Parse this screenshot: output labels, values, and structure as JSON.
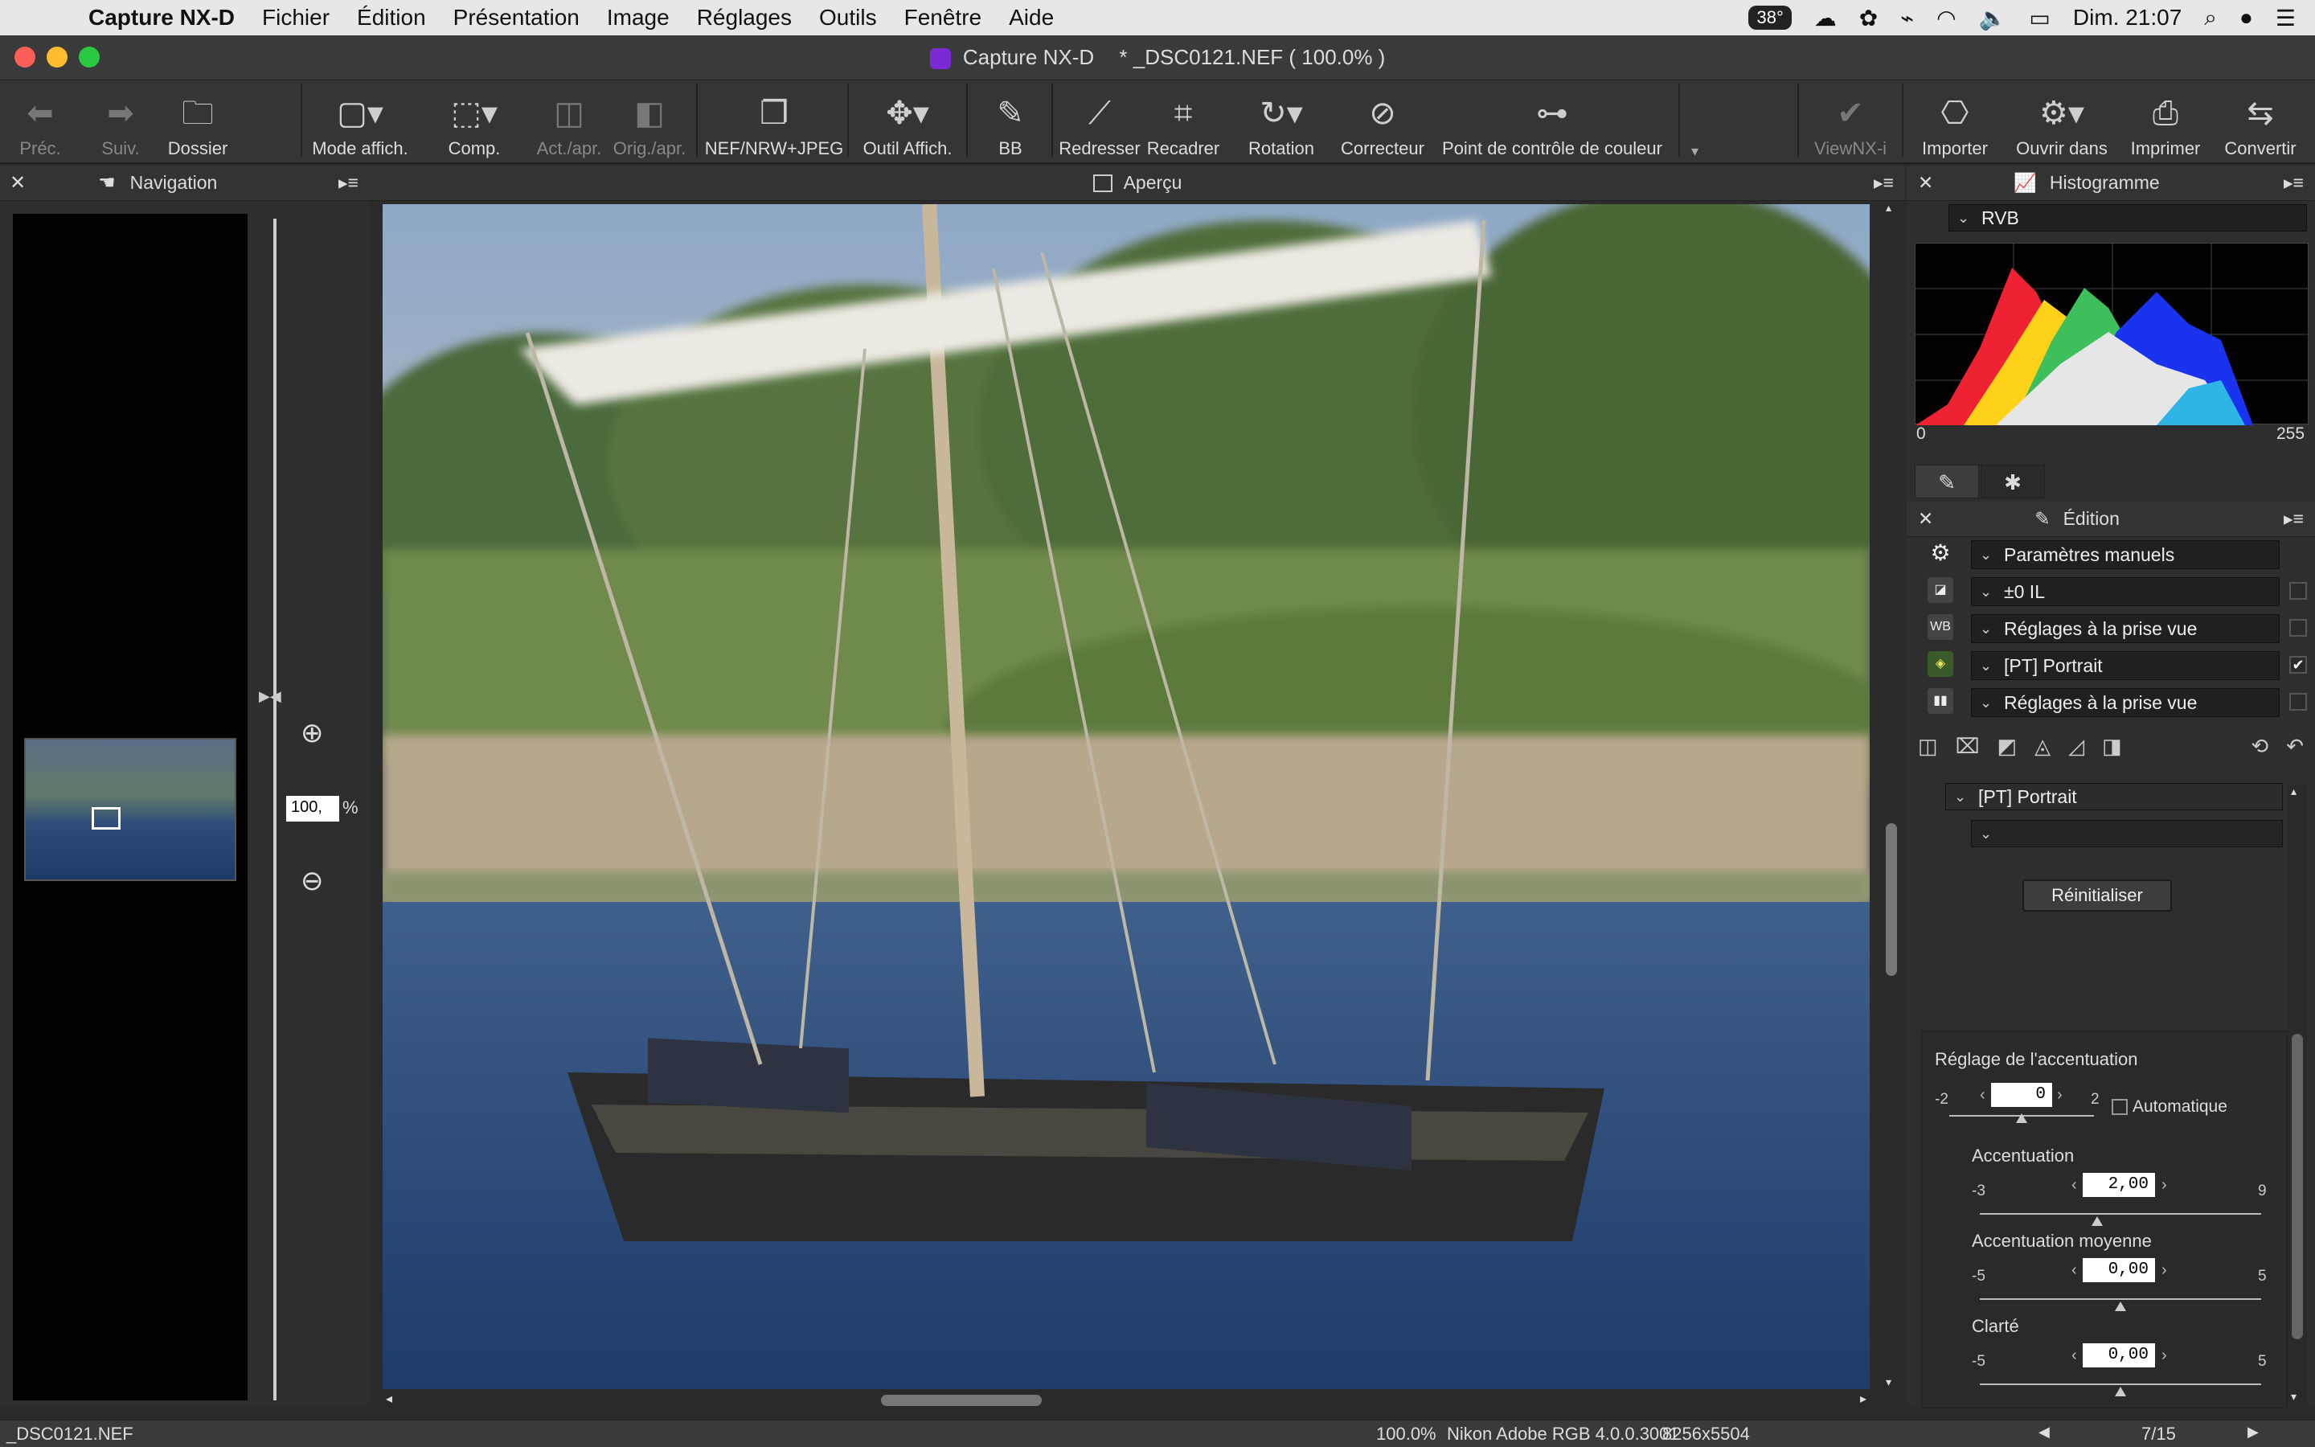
{
  "menubar": {
    "app": "Capture NX-D",
    "items": [
      "Fichier",
      "Édition",
      "Présentation",
      "Image",
      "Réglages",
      "Outils",
      "Fenêtre",
      "Aide"
    ],
    "temp": "38°",
    "clock": "Dim. 21:07"
  },
  "window": {
    "title": "Capture NX-D",
    "doc": "* _DSC0121.NEF ( 100.0% )"
  },
  "toolbar": {
    "prev": "Préc.",
    "next": "Suiv.",
    "folder": "Dossier",
    "view_mode": "Mode affich.",
    "comp": "Comp.",
    "before_after": "Act./apr.",
    "orig_after": "Orig./apr.",
    "nef_jpeg": "NEF/NRW+JPEG",
    "view_tool": "Outil Affich.",
    "wb": "BB",
    "straighten": "Redresser",
    "crop": "Recadrer",
    "rotate": "Rotation",
    "retouch": "Correcteur",
    "color_control": "Point de contrôle de couleur",
    "viewnx": "ViewNX-i",
    "import": "Importer",
    "open_in": "Ouvrir dans",
    "print": "Imprimer",
    "convert": "Convertir"
  },
  "navigation": {
    "title": "Navigation",
    "zoom_value": "100,",
    "zoom_unit": "%"
  },
  "preview": {
    "title": "Aperçu"
  },
  "histogram": {
    "title": "Histogramme",
    "channel": "RVB",
    "min": "0",
    "max": "255"
  },
  "edit": {
    "title": "Édition",
    "rows": [
      {
        "icon": "gear",
        "label": "Paramètres manuels"
      },
      {
        "icon": "exposure",
        "label": "±0 IL"
      },
      {
        "icon": "WB",
        "label": "Réglages à la prise vue"
      },
      {
        "icon": "picture-control",
        "label": "[PT] Portrait"
      },
      {
        "icon": "noise",
        "label": "Réglages à la prise vue"
      }
    ],
    "picture_control": "[PT] Portrait",
    "reset": "Réinitialiser",
    "sharpening": {
      "title": "Réglage de l'accentuation",
      "quick": {
        "min": "-2",
        "max": "2",
        "value": "0",
        "fraction": 0.5
      },
      "auto_label": "Automatique",
      "sliders": [
        {
          "label": "Accentuation",
          "min": "-3",
          "max": "9",
          "value": "2,00",
          "fraction": 0.4167
        },
        {
          "label": "Accentuation moyenne",
          "min": "-5",
          "max": "5",
          "value": "0,00",
          "fraction": 0.5
        },
        {
          "label": "Clarté",
          "min": "-5",
          "max": "5",
          "value": "0,00",
          "fraction": 0.5
        }
      ]
    }
  },
  "status": {
    "file": "_DSC0121.NEF",
    "zoom": "100.0%",
    "profile": "Nikon Adobe RGB 4.0.0.3001",
    "size": "8256x5504",
    "page": "7/15"
  }
}
